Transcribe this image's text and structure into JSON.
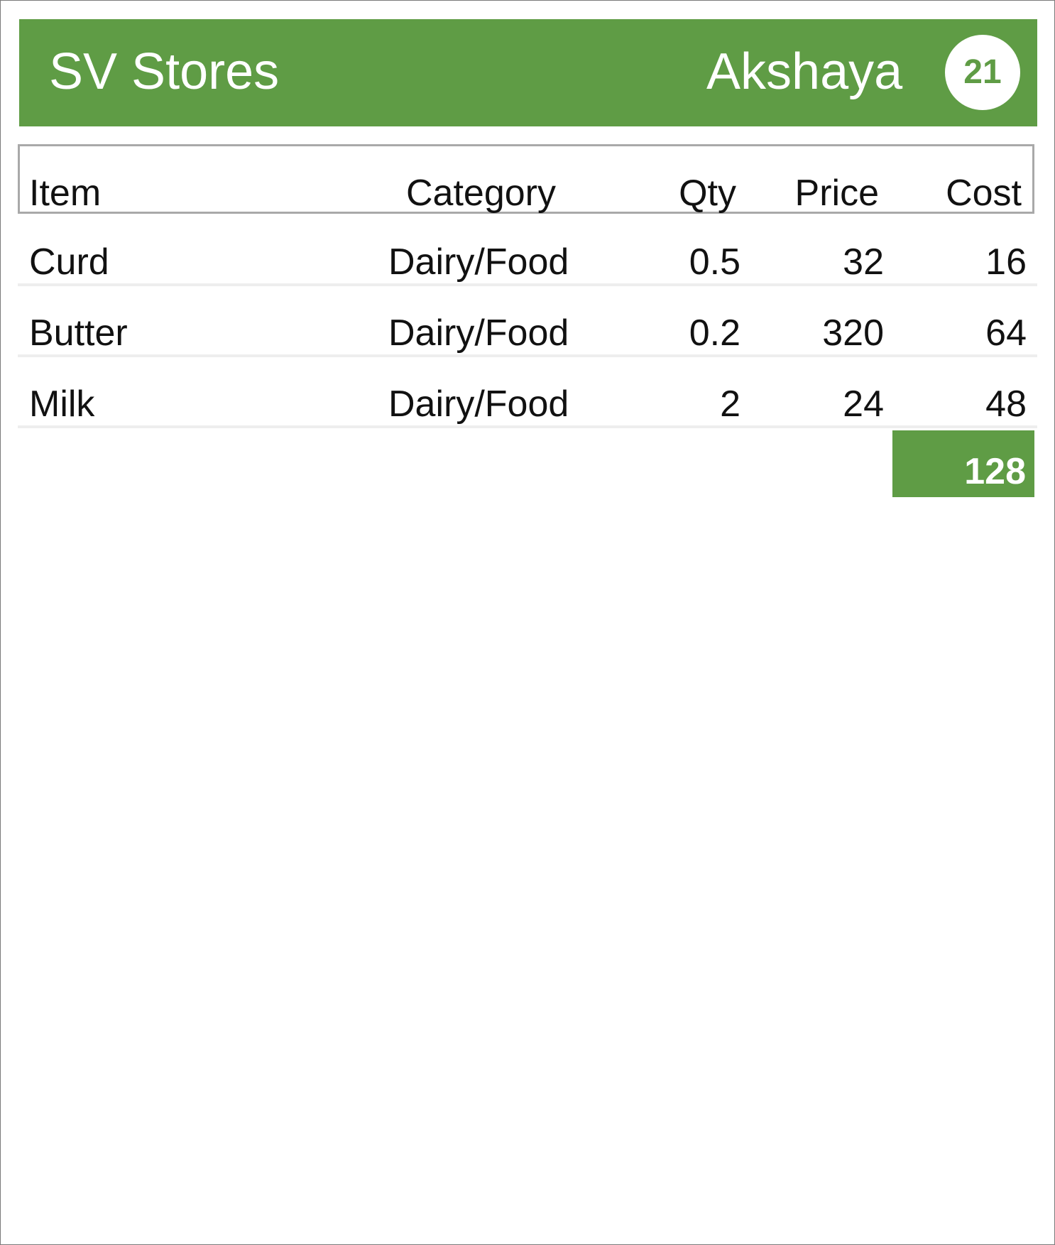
{
  "header": {
    "store_name": "SV Stores",
    "customer_name": "Akshaya",
    "badge_count": "21"
  },
  "table": {
    "columns": [
      "Item",
      "Category",
      "Qty",
      "Price",
      "Cost"
    ],
    "rows": [
      {
        "item": "Curd",
        "category": "Dairy/Food",
        "qty": "0.5",
        "price": "32",
        "cost": "16"
      },
      {
        "item": "Butter",
        "category": "Dairy/Food",
        "qty": "0.2",
        "price": "320",
        "cost": "64"
      },
      {
        "item": "Milk",
        "category": "Dairy/Food",
        "qty": "2",
        "price": "24",
        "cost": "48"
      }
    ],
    "total": "128"
  },
  "colors": {
    "accent": "#5f9c45",
    "header_text": "#ffffff",
    "border": "#a9a9a9",
    "row_divider": "#eeeeee"
  }
}
